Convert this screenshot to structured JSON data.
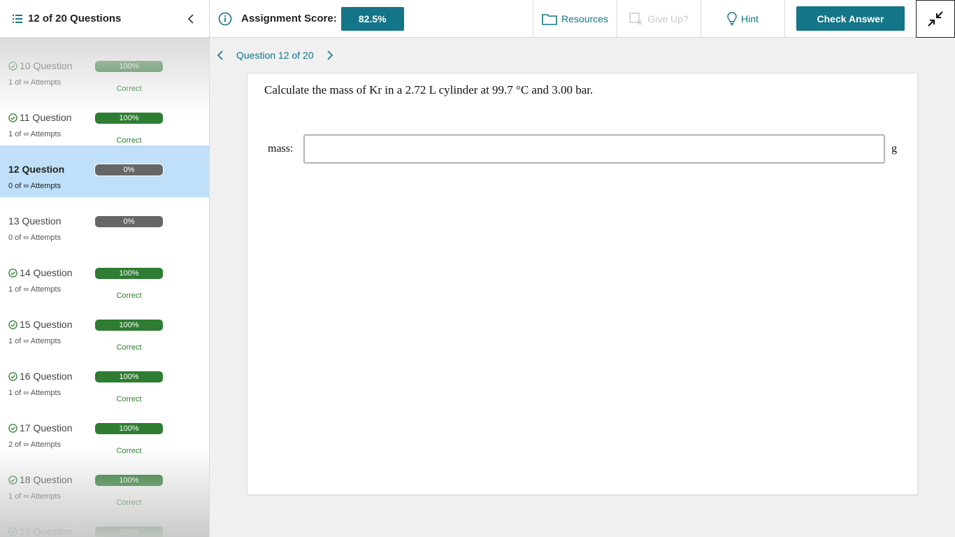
{
  "sidebar": {
    "title": "12 of 20 Questions",
    "items": [
      {
        "name": "10 Question",
        "attempts": "1 of ∞ Attempts",
        "percent": "100%",
        "status": "Correct",
        "state": "correct",
        "active": false
      },
      {
        "name": "11 Question",
        "attempts": "1 of ∞ Attempts",
        "percent": "100%",
        "status": "Correct",
        "state": "correct",
        "active": false
      },
      {
        "name": "12 Question",
        "attempts": "0 of ∞ Attempts",
        "percent": "0%",
        "status": "",
        "state": "none",
        "active": true
      },
      {
        "name": "13 Question",
        "attempts": "0 of ∞ Attempts",
        "percent": "0%",
        "status": "",
        "state": "none",
        "active": false
      },
      {
        "name": "14 Question",
        "attempts": "1 of ∞ Attempts",
        "percent": "100%",
        "status": "Correct",
        "state": "correct",
        "active": false
      },
      {
        "name": "15 Question",
        "attempts": "1 of ∞ Attempts",
        "percent": "100%",
        "status": "Correct",
        "state": "correct",
        "active": false
      },
      {
        "name": "16 Question",
        "attempts": "1 of ∞ Attempts",
        "percent": "100%",
        "status": "Correct",
        "state": "correct",
        "active": false
      },
      {
        "name": "17 Question",
        "attempts": "2 of ∞ Attempts",
        "percent": "100%",
        "status": "Correct",
        "state": "correct",
        "active": false
      },
      {
        "name": "18 Question",
        "attempts": "1 of ∞ Attempts",
        "percent": "100%",
        "status": "Correct",
        "state": "correct",
        "active": false
      },
      {
        "name": "19 Question",
        "attempts": "",
        "percent": "100%",
        "status": "",
        "state": "correct",
        "active": false
      }
    ]
  },
  "topbar": {
    "score_label": "Assignment Score:",
    "score_value": "82.5%",
    "resources_label": "Resources",
    "giveup_label": "Give Up?",
    "hint_label": "Hint",
    "check_answer_label": "Check Answer"
  },
  "qnav": {
    "label": "Question 12 of 20"
  },
  "question": {
    "text": "Calculate the mass of Kr in a 2.72 L cylinder at 99.7 °C and 3.00 bar.",
    "answer_label": "mass:",
    "answer_value": "",
    "answer_unit": "g"
  },
  "colors": {
    "accent": "#137587",
    "correct": "#2e7d32",
    "incomplete": "#666666",
    "active_row": "#bfe0f8"
  }
}
